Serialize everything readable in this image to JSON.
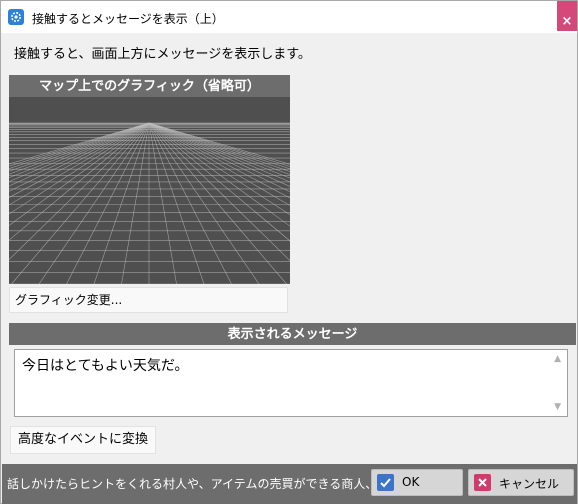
{
  "window": {
    "title": "接触するとメッセージを表示（上）",
    "close_glyph": "×"
  },
  "description": "接触すると、画面上方にメッセージを表示します。",
  "graphic": {
    "header": "マップ上でのグラフィック（省略可）",
    "change_button": "グラフィック変更..."
  },
  "message": {
    "header": "表示されるメッセージ",
    "text": "今日はとてもよい天気だ。",
    "scroll_up_glyph": "▲",
    "scroll_down_glyph": "▼"
  },
  "convert_button": "高度なイベントに変換",
  "footer": {
    "hint": "話しかけたらヒントをくれる村人や、アイテムの売買ができる商人、お金",
    "ok_label": "OK",
    "cancel_label": "キャンセル"
  },
  "colors": {
    "close_button": "#d4487a",
    "panel_header": "#6d6d6d",
    "ok_icon": "#3d73c9",
    "cancel_icon": "#cf3c6c"
  },
  "icons": {
    "app": "gear-app-icon",
    "ok": "check-icon",
    "cancel": "x-icon"
  }
}
